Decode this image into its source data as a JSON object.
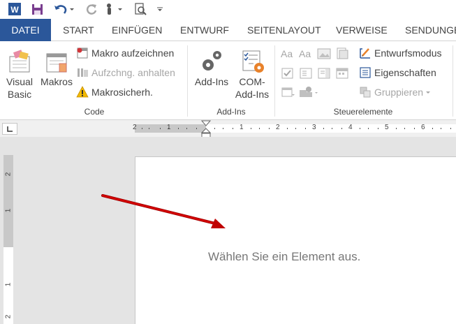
{
  "quick_access": {
    "app_icon": "word-icon",
    "items": [
      {
        "name": "save-icon"
      },
      {
        "name": "undo-icon"
      },
      {
        "name": "redo-icon"
      },
      {
        "name": "touch-mode-icon"
      },
      {
        "name": "print-preview-icon"
      },
      {
        "name": "customize-icon"
      }
    ]
  },
  "tabs": [
    {
      "label": "DATEI"
    },
    {
      "label": "START"
    },
    {
      "label": "EINFÜGEN"
    },
    {
      "label": "ENTWURF"
    },
    {
      "label": "SEITENLAYOUT"
    },
    {
      "label": "VERWEISE"
    },
    {
      "label": "SENDUNGEN"
    }
  ],
  "ribbon": {
    "code": {
      "label": "Code",
      "visual_basic": "Visual\nBasic",
      "visual_basic_l1": "Visual",
      "visual_basic_l2": "Basic",
      "makros": "Makros",
      "record": "Makro aufzeichnen",
      "pause": "Aufzchng. anhalten",
      "security": "Makrosicherh."
    },
    "addins": {
      "label": "Add-Ins",
      "addins_btn": "Add-Ins",
      "com_l1": "COM-",
      "com_l2": "Add-Ins"
    },
    "controls": {
      "label": "Steuerelemente",
      "design_mode": "Entwurfsmodus",
      "properties": "Eigenschaften",
      "group": "Gruppieren"
    }
  },
  "ruler": {
    "h_labels": [
      "2",
      "1",
      "1",
      "1",
      "2",
      "3",
      "4",
      "5",
      "6"
    ],
    "v_labels": [
      "2",
      "1",
      "1",
      "2"
    ]
  },
  "document": {
    "prompt": "Wählen Sie ein Element aus."
  },
  "colors": {
    "file_tab": "#2b579a",
    "arrow": "#c00000",
    "word_blue": "#2b579a"
  }
}
